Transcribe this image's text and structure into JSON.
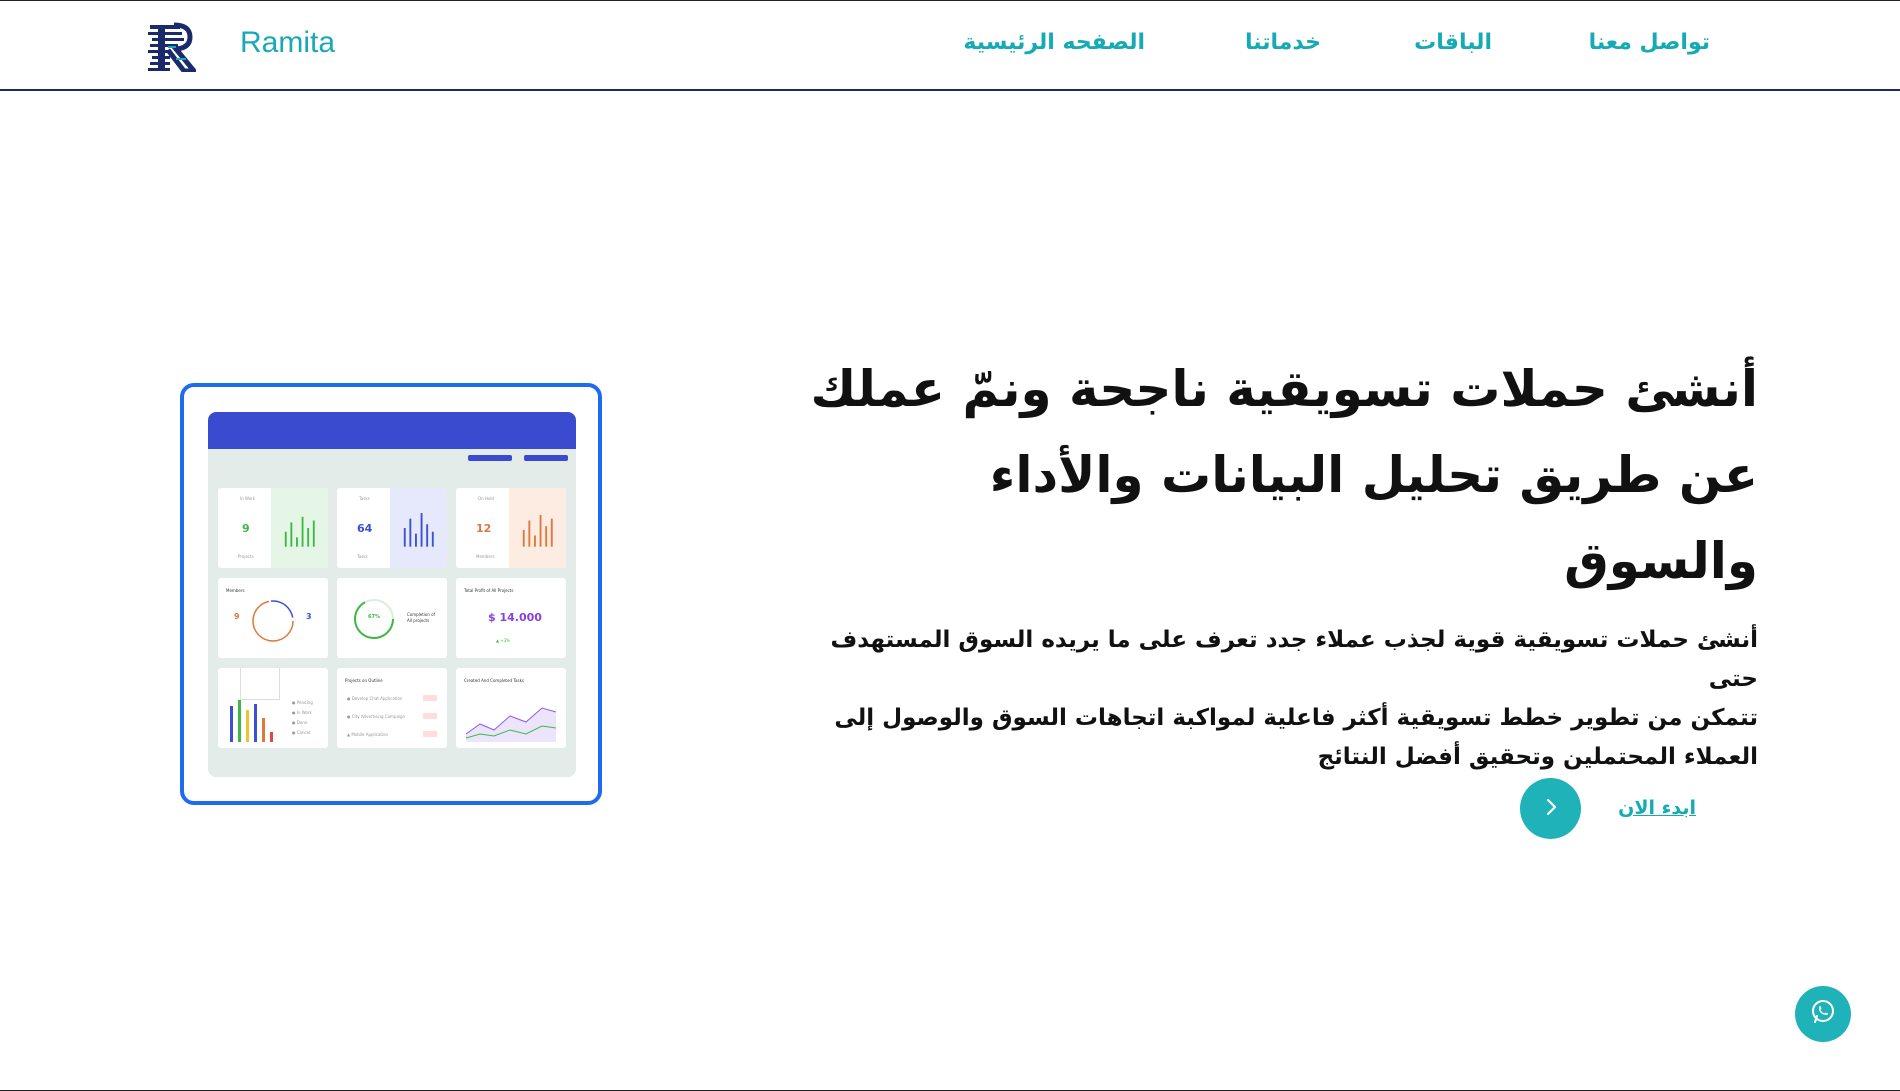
{
  "header": {
    "brand": "Ramita",
    "nav": [
      {
        "label": "تواصل معنا"
      },
      {
        "label": "الباقات"
      },
      {
        "label": "خدماتنا"
      },
      {
        "label": "الصفحه الرئيسية"
      }
    ]
  },
  "hero": {
    "title_lines": [
      "أنشئ حملات تسويقية ناجحة ونمّ عملك",
      "عن طريق تحليل البيانات والأداء",
      "والسوق"
    ],
    "subtitle_lines": [
      "أنشئ حملات تسويقية قوية لجذب عملاء جدد تعرف على ما يريده السوق المستهدف حتى",
      "تتمكن من تطوير خطط تسويقية أكثر فاعلية لمواكبة اتجاهات السوق والوصول إلى",
      "العملاء المحتملين وتحقيق أفضل النتائج"
    ],
    "cta_label": "ابدء الان"
  },
  "illustration": {
    "tiles": [
      {
        "number": "9",
        "color": "#3cb944",
        "shade": "#e6f6e6"
      },
      {
        "number": "64",
        "color": "#3b50d6",
        "shade": "#e6e9fb"
      },
      {
        "number": "12",
        "color": "#e0773d",
        "shade": "#fdece2"
      }
    ],
    "money": "$ 14.000",
    "ring_left": "9",
    "ring_right": "3",
    "percent": "67%"
  },
  "icons": {
    "cta": "chevron-right-icon",
    "whatsapp": "whatsapp-icon",
    "logo": "r-logo-icon"
  },
  "colors": {
    "accent": "#1fb2b8",
    "nav_text": "#16aab4",
    "header_border": "#1b2a6b",
    "card_border": "#1d6cf0",
    "dashboard_bar": "#3b4bcf"
  }
}
